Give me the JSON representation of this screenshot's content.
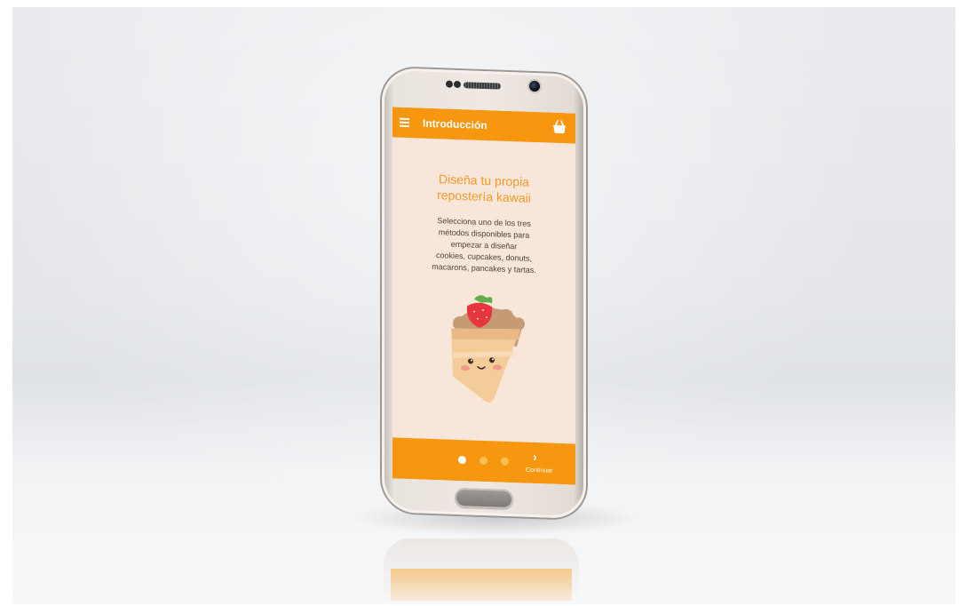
{
  "app": {
    "title": "Introducción"
  },
  "intro": {
    "headline_line1": "Diseña tu propia",
    "headline_line2": "repostería kawaii",
    "body_line1": "Selecciona uno de los tres",
    "body_line2": "métodos disponibles para",
    "body_line3": "empezar a diseñar",
    "body_line4": "cookies, cupcakes, donuts,",
    "body_line5": "macarons, pancakes y tartas."
  },
  "pager": {
    "pages": 3,
    "current": 1,
    "next_label": "Continuar",
    "next_icon": "chevron-right-icon"
  },
  "icons": {
    "menu": "menu-icon",
    "cart": "basket-icon"
  },
  "colors": {
    "accent": "#f7960f",
    "headline": "#f39a25",
    "screen_bg": "#f8e6da",
    "dot_inactive": "#f6bf52"
  }
}
